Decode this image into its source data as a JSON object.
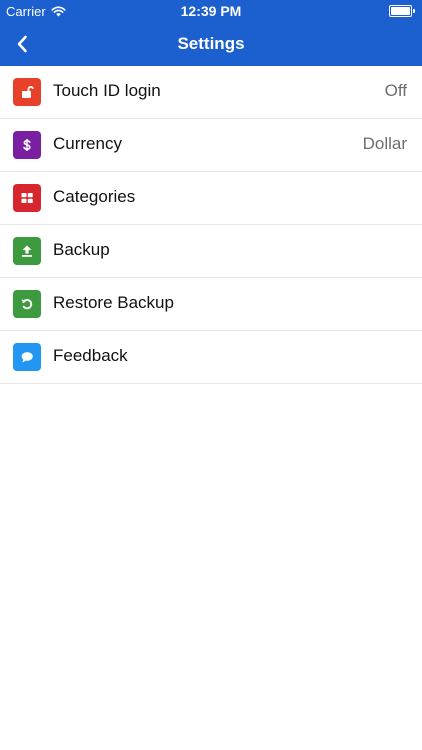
{
  "status_bar": {
    "carrier": "Carrier",
    "time": "12:39 PM"
  },
  "nav": {
    "title": "Settings",
    "back_icon": "chevron-left-icon"
  },
  "settings": [
    {
      "label": "Touch ID login",
      "value": "Off",
      "icon": "unlock-icon",
      "color": "#e8412a"
    },
    {
      "label": "Currency",
      "value": "Dollar",
      "icon": "dollar-icon",
      "color": "#7b1fa2"
    },
    {
      "label": "Categories",
      "value": "",
      "icon": "grid-icon",
      "color": "#d8262f"
    },
    {
      "label": "Backup",
      "value": "",
      "icon": "upload-icon",
      "color": "#3d9a3e"
    },
    {
      "label": "Restore Backup",
      "value": "",
      "icon": "restore-icon",
      "color": "#3d9a3e"
    },
    {
      "label": "Feedback",
      "value": "",
      "icon": "chat-bubble-icon",
      "color": "#2196f3"
    }
  ],
  "colors": {
    "header": "#1c5fce",
    "divider": "#e6e6e6",
    "value_text": "#6d6d6d"
  }
}
